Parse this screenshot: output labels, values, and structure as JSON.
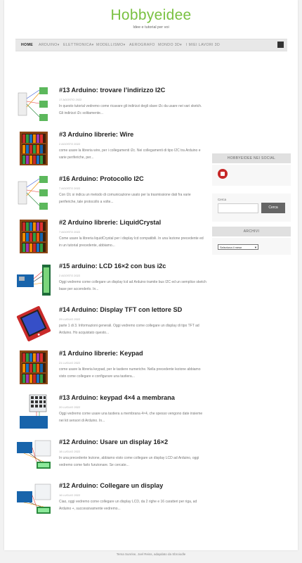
{
  "site": {
    "title": "Hobbyeidee",
    "tagline": "Idee e tutorial per voi"
  },
  "nav": {
    "items": [
      {
        "label": "HOME",
        "arrow": ""
      },
      {
        "label": "ARDUINO",
        "arrow": "▾"
      },
      {
        "label": "ELETTRONICA",
        "arrow": "▾"
      },
      {
        "label": "MODELLISMO",
        "arrow": "▾"
      },
      {
        "label": "AEROGRAFO",
        "arrow": ""
      },
      {
        "label": "MONDO 3D",
        "arrow": "▾"
      },
      {
        "label": "I MIEI LAVORI 3D",
        "arrow": ""
      }
    ]
  },
  "posts": [
    {
      "title": "#13 Arduino: trovare l’indirizzo I2C",
      "date": "17 AGOSTO 2022",
      "excerpt": "In questo tutorial vedremo come ricavare gli indirizzi degli slave i2c da usare nei vari sketch. Gli indirizzi i2c solitamente...",
      "thumb": "i2c"
    },
    {
      "title": "#3 Arduino librerie: Wire",
      "date": "2 AGOSTO 2022",
      "excerpt": "come usare la libreria wire, per i collegamenti i2c. Nei collegamenti di tipo I2C tra Arduino e varie periferiche, per...",
      "thumb": "books"
    },
    {
      "title": "#16 Arduino: Protocollo I2C",
      "date": "7 AGOSTO 2022",
      "excerpt": "Con I2c si indica un metodo di comunicazione usato per la trasmissione dati fra varie periferiche, tale protocollo a volte...",
      "thumb": "i2c"
    },
    {
      "title": "#2 Arduino librerie: LiquidCrystal",
      "date": "7 AGOSTO 2022",
      "excerpt": "Come usare la libreria liquidCrystal per i display lcd compatibili. In una lezione precedente ed in un tutorial precedente, abbiamo...",
      "thumb": "books"
    },
    {
      "title": "#15 arduino: LCD 16×2 con bus i2c",
      "date": "2 AGOSTO 2022",
      "excerpt": "Oggi vedremo come collegare un display lcd ad Arduino tramite bus I2C ed un semplice sketch base per accenderlo. In...",
      "thumb": "lcd"
    },
    {
      "title": "#14 Arduino: Display TFT con lettore SD",
      "date": "29 LUGLIO 2022",
      "excerpt": "parte 1 di 3. Informazioni generali. Oggi vedremo come collegare un display di tipo TFT ad Arduino. Ho acquistato questo...",
      "thumb": "tft"
    },
    {
      "title": "#1 Arduino librerie: Keypad",
      "date": "21 LUGLIO 2022",
      "excerpt": "come usare la libreria keypad, per le tastiere numeriche. Nella precedente lezione abbiamo visto come collegare e configurare una tastiera...",
      "thumb": "books"
    },
    {
      "title": "#13 Arduino: keypad 4×4 a membrana",
      "date": "20 LUGLIO 2022",
      "excerpt": "Oggi vedremo come usare una tastiera a membrana 4×4, che spesso vengono date insieme nei kit sensori di Arduino. In...",
      "thumb": "keypad"
    },
    {
      "title": "#12 Arduino: Usare un display 16×2",
      "date": "18 LUGLIO 2022",
      "excerpt": "In una precedente lezione, abbiamo visto come collegare un display LCD ad Arduino, oggi vedremo come farlo funzionare. Se cercate...",
      "thumb": "wiring"
    },
    {
      "title": "#12 Arduino: Collegare un display",
      "date": "16 LUGLIO 2022",
      "excerpt": "Ciao, oggi vedremo come collegare un display LCD, da 2 righe e 16 caratteri per riga, ad Arduino +, successivamente vedremo...",
      "thumb": "wiring"
    }
  ],
  "sidebar": {
    "social_title": "HOBBYEIDEE NEI SOCIAL",
    "search_label": "Cerca",
    "search_button": "Cerca",
    "archive_title": "ARCHIVI",
    "archive_select": "Seleziona il mese"
  },
  "footer": {
    "text": "Tema Sunrise, Joel Reiss, adapdato da Sbroiodle"
  },
  "colors": {
    "accent": "#7ac142",
    "youtube": "#c62828"
  }
}
